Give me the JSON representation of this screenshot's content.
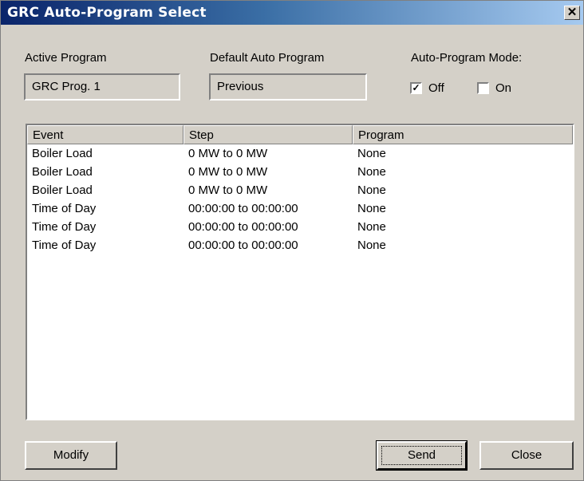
{
  "window": {
    "title": "GRC Auto-Program Select",
    "close_glyph": "✕"
  },
  "active_program": {
    "label": "Active Program",
    "value": "GRC Prog. 1"
  },
  "default_program": {
    "label": "Default Auto Program",
    "value": "Previous"
  },
  "mode": {
    "label": "Auto-Program Mode:",
    "off": {
      "label": "Off",
      "checked": true
    },
    "on": {
      "label": "On",
      "checked": false
    }
  },
  "table": {
    "columns": [
      "Event",
      "Step",
      "Program"
    ],
    "rows": [
      [
        "Boiler Load",
        "0 MW to 0 MW",
        "None"
      ],
      [
        "Boiler Load",
        "0 MW to 0 MW",
        "None"
      ],
      [
        "Boiler Load",
        "0 MW to 0 MW",
        "None"
      ],
      [
        "Time of Day",
        "00:00:00 to 00:00:00",
        "None"
      ],
      [
        "Time of Day",
        "00:00:00 to 00:00:00",
        "None"
      ],
      [
        "Time of Day",
        "00:00:00 to 00:00:00",
        "None"
      ]
    ]
  },
  "buttons": {
    "modify": "Modify",
    "send": "Send",
    "close": "Close"
  }
}
